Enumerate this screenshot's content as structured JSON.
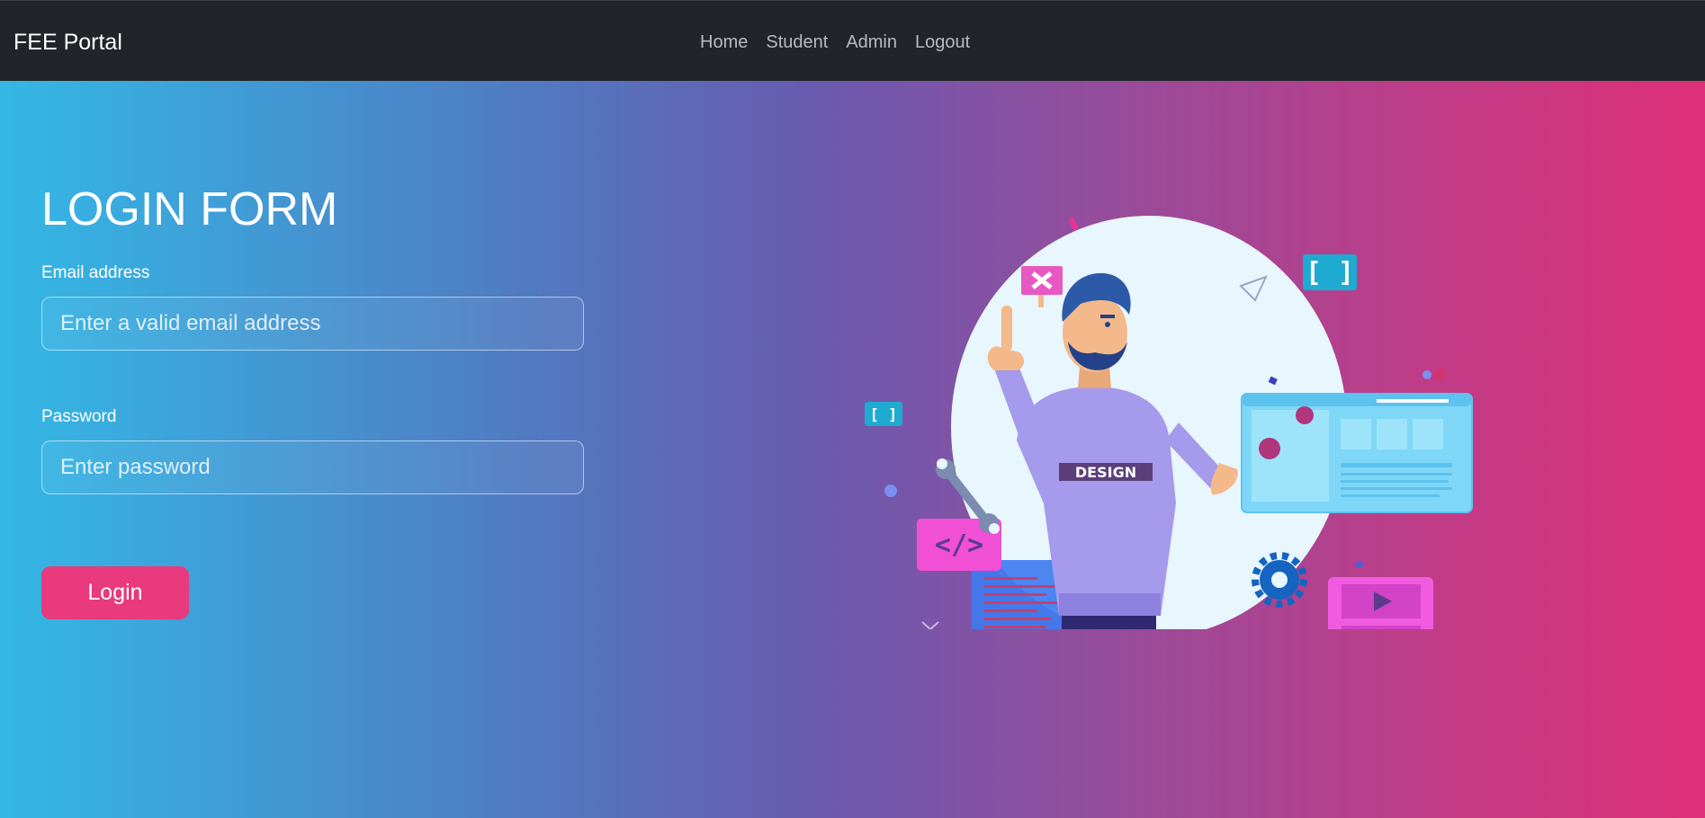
{
  "navbar": {
    "brand": "FEE Portal",
    "links": [
      {
        "label": "Home"
      },
      {
        "label": "Student"
      },
      {
        "label": "Admin"
      },
      {
        "label": "Logout"
      }
    ]
  },
  "form": {
    "title": "LOGIN FORM",
    "email_label": "Email address",
    "email_placeholder": "Enter a valid email address",
    "password_label": "Password",
    "password_placeholder": "Enter password",
    "submit_label": "Login"
  },
  "illustration": {
    "shirt_text": "DESIGN",
    "icons": [
      "close-icon",
      "code-icon",
      "brackets-icon",
      "wrench-icon",
      "gear-icon",
      "play-icon"
    ]
  },
  "colors": {
    "navbar_bg": "#212529",
    "gradient_start": "#33b8e6",
    "gradient_end": "#de2f79",
    "button_bg": "#e83a7c"
  }
}
